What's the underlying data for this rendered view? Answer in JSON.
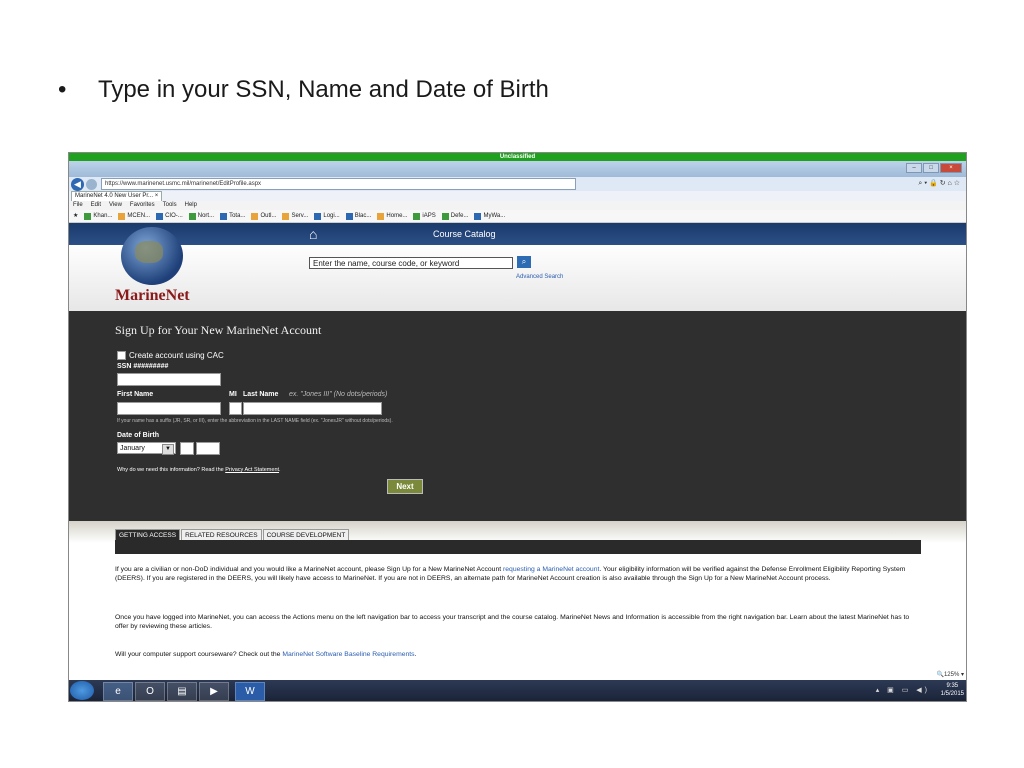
{
  "slide": {
    "bullet_symbol": "•",
    "bullet_text": "Type in your SSN, Name and Date of Birth"
  },
  "browser": {
    "classification_banner": "Unclassified",
    "address": "https://www.marinenet.usmc.mil/marinenet/EditProfile.aspx",
    "tab_title": "MarineNet 4.0 New User Pr...",
    "menu": [
      "File",
      "Edit",
      "View",
      "Favorites",
      "Tools",
      "Help"
    ],
    "favorites": [
      "Khan...",
      "MCEN...",
      "CIO-...",
      "Nort...",
      "Tota...",
      "Outl...",
      "Serv...",
      "Logi...",
      "Blac...",
      "Home...",
      "iAPS",
      "Defe...",
      "MyWa..."
    ],
    "status_zoom": "125%"
  },
  "site": {
    "logo_text": "MarineNet",
    "course_catalog_label": "Course Catalog",
    "search_value": "Enter the name, course code, or keyword",
    "advanced_search": "Advanced Search"
  },
  "signup": {
    "title": "Sign Up for Your New MarineNet Account",
    "cac_label": "Create account using CAC",
    "ssn_label": "SSN #########",
    "first_name_label": "First Name",
    "mi_label": "MI",
    "last_name_label": "Last Name",
    "last_name_hint": "ex. \"Jones III\" (No dots/periods)",
    "suffix_note": "If your name has a suffix (JR, SR, or III), enter the abbreviation in the LAST NAME field (ex. \"JonesJR\" without dots/periods).",
    "dob_label": "Date of Birth",
    "dob_month": "January",
    "privacy_prefix": "Why do we need this information? Read the",
    "privacy_link": "Privacy Act Statement",
    "next_label": "Next"
  },
  "info": {
    "tabs": [
      "GETTING ACCESS",
      "RELATED RESOURCES",
      "COURSE DEVELOPMENT"
    ],
    "p1_start": "If you are a civilian or non-DoD individual and you would like a MarineNet account, please Sign Up for a New MarineNet Account",
    "p1_link": "requesting a MarineNet account",
    "p1_end": ". Your eligibility information will be verified against the Defense Enrollment Eligibility Reporting System (DEERS). If you are registered in the DEERS, you will likely have access to MarineNet. If you are not in DEERS, an alternate path for MarineNet Account creation is also available through the Sign Up for a New MarineNet Account process.",
    "p2": "Once you have logged into MarineNet, you can access the Actions menu on the left navigation bar to access your transcript and the course catalog. MarineNet News and Information is accessible from the right navigation bar. Learn about the latest MarineNet has to offer by reviewing these articles.",
    "p3_start": "Will your computer support courseware? Check out the",
    "p3_link": "MarineNet Software Baseline Requirements",
    "p3_end": "."
  },
  "taskbar": {
    "time": "9:35",
    "date": "1/5/2015"
  }
}
